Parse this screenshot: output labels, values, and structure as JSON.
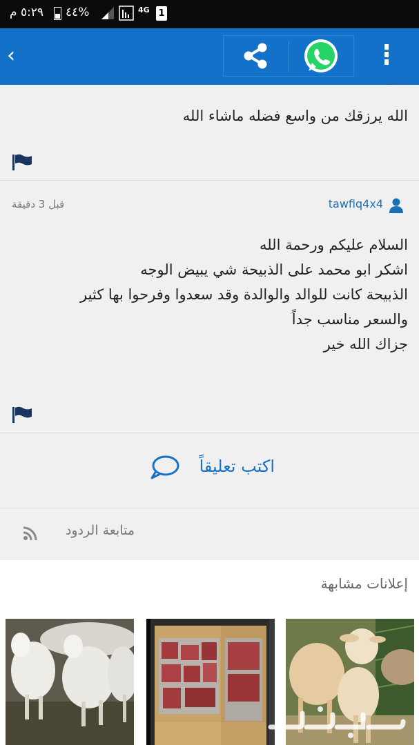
{
  "status_bar": {
    "time": "٥:٢٩ م",
    "battery": "٤٤%",
    "network": "4G"
  },
  "app_bar": {
    "back": "‹"
  },
  "comments": [
    {
      "text": "الله يرزقك من واسع فضله ماشاء الله"
    },
    {
      "author": "tawfiq4x4",
      "time": "قبل 3 دقيقة",
      "lines": [
        "السلام عليكم ورحمة الله",
        "اشكر ابو محمد على الذبيحة شي يبيض الوجه",
        "الذبيحة كانت للوالد والوالدة وقد سعدوا وفرحوا بها كثير",
        "والسعر مناسب جداً",
        "جزاك الله خير"
      ]
    }
  ],
  "write_comment": "اكتب تعليقاً",
  "follow_replies": "متابعة الردود",
  "similar_ads": {
    "title": "إعلانات مشابهة"
  },
  "colors": {
    "app_bar": "#1371c9",
    "link": "#1a6fb5",
    "whatsapp": "#25d366"
  },
  "icons": [
    "back-icon",
    "share-icon",
    "whatsapp-icon",
    "more-icon",
    "flag-icon",
    "user-icon",
    "comment-icon",
    "rss-icon"
  ]
}
